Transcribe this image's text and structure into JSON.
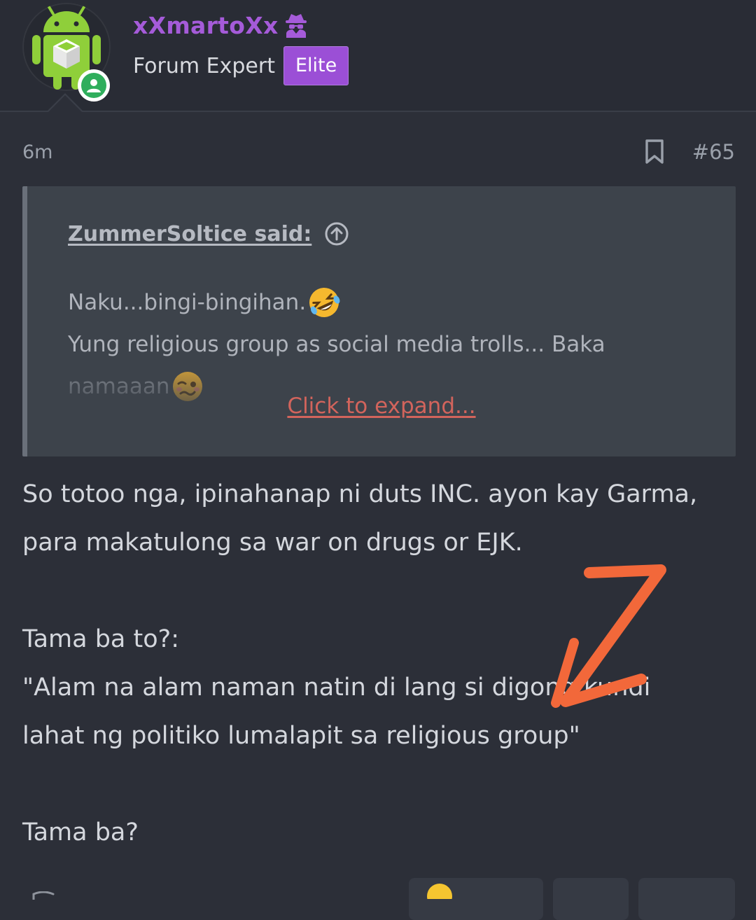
{
  "user": {
    "name": "xXmartoXx",
    "title": "Forum Expert",
    "badge": "Elite",
    "avatar_icon": "android-robot-icon",
    "online": true,
    "accent_color": "#a55bd9"
  },
  "post": {
    "time": "6m",
    "number": "#65",
    "quote": {
      "author": "ZummerSoltice said:",
      "lines": [
        "Naku...bingi-bingihan.",
        "Yung religious group as social media trolls... Baka",
        "namaaan"
      ],
      "emoji_1": "rolling-on-floor-laughing-emoji",
      "emoji_2": "woozy-face-emoji",
      "expand_label": "Click to expand..."
    },
    "body": {
      "line1": "So totoo nga, ipinahanap ni duts INC. ayon kay Garma,",
      "line2": "para makatulong sa war on drugs or EJK.",
      "line3": "Tama ba to?:",
      "line4": "\"Alam na alam naman natin di lang si digong kundi",
      "line5": "lahat ng politiko lumalapit sa religious group\"",
      "line6": "Tama ba?"
    }
  },
  "colors": {
    "background": "#2c2f38",
    "quote_bg": "#3d434b",
    "expand_link": "#d2645c",
    "annotation_arrow": "#f2683a"
  }
}
